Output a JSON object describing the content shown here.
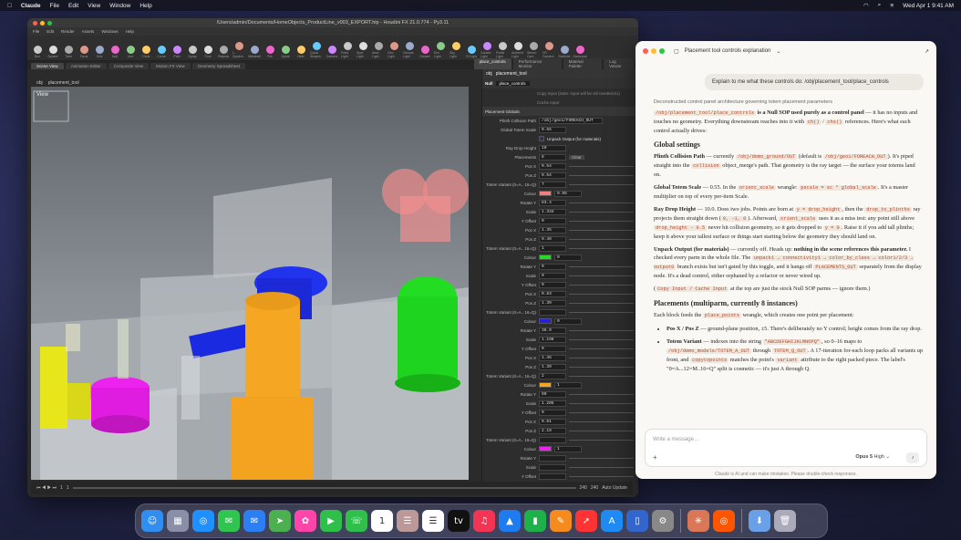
{
  "menubar": {
    "apple": "",
    "app": "Claude",
    "items": [
      "File",
      "Edit",
      "View",
      "Window",
      "Help"
    ],
    "clock": "Wed Apr 1  9:41 AM"
  },
  "houdini": {
    "title": "/Users/admin/Documents/HomeObjects_ProductLine_v003_EXPORT.hip - Houdini FX 21.0.774 - Py3.11",
    "menu": [
      "File",
      "Edit",
      "Render",
      "Assets",
      "Windows",
      "Help"
    ],
    "shelf_tabs": [
      "Create",
      "Modify",
      "Model",
      "Polygon",
      "Deform",
      "Texture",
      "Rigging",
      "Characters",
      "Constraints",
      "Hair Utils",
      "Guide Process",
      "Terrain FX",
      "Simple FX",
      "Volume",
      "Lights and Cameras",
      "Collisions",
      "Particles",
      "Grains",
      "Vellum",
      "RBD",
      "Rigid Bodies",
      "Particle Fl",
      "Viscous Fl",
      "Oceans",
      "SOP Pyro"
    ],
    "tools": [
      "Box",
      "Sphere",
      "Tube",
      "Torus",
      "Grid",
      "Null",
      "Line",
      "Circle",
      "Curve",
      "Path",
      "Spray",
      "Font",
      "Platonic",
      "L-System",
      "Metaball",
      "File",
      "Spiral",
      "Helix",
      "Quick Shapes",
      "Camera",
      "Point Light",
      "Spot Light",
      "Area Light",
      "Geo Light",
      "Volume Light",
      "Distant",
      "Env Light",
      "Sky Light",
      "GI Light",
      "Caustic Light",
      "Portal Light",
      "Ambient Light",
      "Stereo Cam",
      "VR Camera",
      "Switcher",
      "Gamepad"
    ],
    "left_tabs": [
      "Scene View",
      "Animation Editor",
      "Composite View",
      "Motion FX View",
      "Geometry Spreadsheet"
    ],
    "right_tabs": [
      "place_controls",
      "Performance Monitor",
      "Material Palette",
      "Log Viewer"
    ],
    "vp_path": "obj",
    "vp_node": "placement_tool",
    "vp_label": "View",
    "p_path": "obj",
    "p_node": "placement_tool",
    "node_type": "Null",
    "node_name": "place_controls",
    "copy_inputs": [
      "Copy Input (Note: input will be stil needed.Ex)",
      "Cache Input"
    ],
    "folder": "Placement Globals",
    "globals": [
      {
        "label": "Plinth Collision Path",
        "value": "/obj/geo1/FOREACH_OUT"
      },
      {
        "label": "Global Totem Scale",
        "value": "0.55"
      },
      {
        "label": "Unpack Output (for materials)",
        "value": ""
      },
      {
        "label": "Ray Drop Height",
        "value": "10"
      },
      {
        "label": "Placements",
        "value": "8"
      }
    ],
    "clear": "Clear",
    "placements": [
      {
        "px": "0.54",
        "pz": "0.54",
        "tv": "7",
        "col": "#f08080",
        "r": "0.95",
        "ry": "83.4",
        "sc": "1.334",
        "yo": "0"
      },
      {
        "px": "1.35",
        "pz": "0.48",
        "tv": "1",
        "col": "#22dd22",
        "r": "0",
        "ry": "0",
        "sc": "0",
        "yo": "0"
      },
      {
        "px": "0.63",
        "pz": "1.39",
        "tv": "",
        "col": "#2222dd",
        "r": "0",
        "ry": "38.9",
        "sc": "1.198",
        "yo": "0"
      },
      {
        "px": "1.45",
        "pz": "1.39",
        "tv": "2",
        "col": "#f5a623",
        "r": "1",
        "ry": "90",
        "sc": "1.205",
        "yo": "0"
      },
      {
        "px": "0.61",
        "pz": "2.19",
        "tv": "",
        "col": "#ee22ee",
        "r": "1",
        "ry": "",
        "sc": "",
        "yo": ""
      }
    ],
    "row_labels": {
      "px": "Pos X",
      "pz": "Pos Z",
      "tv": "Totem Variant (0=A.. 16=Q)",
      "col": "Colour",
      "ry": "Rotate Y",
      "sc": "Scale",
      "yo": "Y Offset"
    },
    "frame_start": "1",
    "frame_cur": "1",
    "frame_end": "240",
    "frame_end2": "240",
    "auto_update": "Auto Update"
  },
  "claude": {
    "title": "Placement tool controls explanation",
    "user_msg": "Explain to me what these controls do: /obj/placement_tool/place_controls",
    "intro_note": "Deconstructed control panel architecture governing totem placement parameters",
    "p1a": "/obj/placement_tool/place_controls",
    "p1b": " is a Null SOP used purely as a control panel",
    "p1c": " — it has no inputs and touches no geometry. Everything downstream reaches into it with ",
    "p1d": "ch()",
    "p1e": " / ",
    "p1f": "chs()",
    "p1g": " references. Here's what each control actually drives:",
    "h_global": "Global settings",
    "g1_b": "Plinth Collision Path",
    "g1_t": " — currently ",
    "g1_c": "/obj/demo_ground/OUT",
    "g1_t2": " (default is ",
    "g1_c2": "/obj/geo1/FOREACH_OUT",
    "g1_t3": "). It's piped straight into the ",
    "g1_c3": "collision",
    "g1_t4": " object_merge's path. That geometry is the ray target — the surface your totems land on.",
    "g2_b": "Global Totem Scale",
    "g2_t": " — 0.55. In the ",
    "g2_c": "orient_scale",
    "g2_t2": " wrangle: ",
    "g2_c2": "pscale = sc * global_scale",
    "g2_t3": ". It's a master multiplier on top of every per-item Scale.",
    "g3_b": "Ray Drop Height",
    "g3_t": " — 10.0. Does two jobs. Points are born at ",
    "g3_c": "y = drop_height",
    "g3_t2": ", then the ",
    "g3_c2": "drop_to_plinths",
    "g3_t3": " ray projects them straight down (",
    "g3_c3": "0, -1, 0",
    "g3_t4": "). Afterward, ",
    "g3_c4": "orient_scale",
    "g3_t5": " uses it as a miss test: any point still above ",
    "g3_c5": "drop_height - 0.5",
    "g3_t6": " never hit collision geometry, so it gets dropped to ",
    "g3_c6": "y = 0",
    "g3_t7": ". Raise it if you add tall plinths; keep it above your tallest surface or things start starting below the geometry they should land on.",
    "g4_b": "Unpack Output (for materials)",
    "g4_t": " — currently off. Heads up: ",
    "g4_b2": "nothing in the scene references this parameter.",
    "g4_t2": " I checked every parm in the whole file. The ",
    "g4_c": "unpack1 → connectivity1 → color_by_class → color1/2/3 → output0",
    "g4_t3": " branch exists but isn't gated by this toggle, and it hangs off ",
    "g4_c2": "PLACEMENTS_OUT",
    "g4_t4": " separately from the display node. It's a dead control, either orphaned by a refactor or never wired up.",
    "g5_t": "(",
    "g5_c": "Copy Input / Cache Input",
    "g5_t2": " at the top are just the stock Null SOP parms — ignore them.)",
    "h_place": "Placements (multiparm, currently 8 instances)",
    "pl_t": "Each block feeds the ",
    "pl_c": "place_points",
    "pl_t2": " wrangle, which creates one point per placement:",
    "b1_b": "Pos X / Pos Z",
    "b1_t": " — ground-plane position, ±5. There's deliberately no Y control; height comes from the ray drop.",
    "b2_b": "Totem Variant",
    "b2_t": " — indexes into the string ",
    "b2_c": "\"ABCDEFGHIJKLMNOPQ\"",
    "b2_t2": ", so 0–16 maps to ",
    "b2_c2": "/obj/demo_models/TOTEM_A_OUT",
    "b2_t3": " through ",
    "b2_c3": "TOTEM_Q_OUT",
    "b2_t4": ". A 17-iteration for-each loop packs all variants up front, and ",
    "b2_c4": "copytopoints",
    "b2_t5": " matches the point's ",
    "b2_c5": "variant",
    "b2_t6": " attribute to the right packed piece. The label's \"0=A...12=M..16=Q\" split is cosmetic — it's just A through Q.",
    "input_placeholder": "Write a message…",
    "plus": "+",
    "model": "Opus 5",
    "effort": "High",
    "footer": "Claude is AI and can make mistakes. Please double-check responses."
  },
  "dock": [
    {
      "name": "finder",
      "color": "#2f8ef0",
      "glyph": "☺"
    },
    {
      "name": "launchpad",
      "color": "#8a8fa8",
      "glyph": "▦"
    },
    {
      "name": "safari",
      "color": "#1e90ff",
      "glyph": "◎"
    },
    {
      "name": "messages",
      "color": "#30c450",
      "glyph": "✉"
    },
    {
      "name": "mail",
      "color": "#2c7ff2",
      "glyph": "✉"
    },
    {
      "name": "maps",
      "color": "#4caf50",
      "glyph": "➤"
    },
    {
      "name": "photos",
      "color": "#f4a",
      "glyph": "✿"
    },
    {
      "name": "facetime",
      "color": "#2fbf4a",
      "glyph": "▶"
    },
    {
      "name": "phone",
      "color": "#2fbf4a",
      "glyph": "☏"
    },
    {
      "name": "calendar",
      "color": "#ffffff",
      "glyph": "1"
    },
    {
      "name": "contacts",
      "color": "#b99",
      "glyph": "☰"
    },
    {
      "name": "reminders",
      "color": "#ffffff",
      "glyph": "☰"
    },
    {
      "name": "tv",
      "color": "#111",
      "glyph": "tv"
    },
    {
      "name": "music",
      "color": "#f33454",
      "glyph": "♫"
    },
    {
      "name": "keynote",
      "color": "#1e7bf0",
      "glyph": "▲"
    },
    {
      "name": "numbers",
      "color": "#1eb14a",
      "glyph": "▮"
    },
    {
      "name": "pages",
      "color": "#f58a1e",
      "glyph": "✎"
    },
    {
      "name": "news",
      "color": "#f33",
      "glyph": "➚"
    },
    {
      "name": "app-store",
      "color": "#1e8af2",
      "glyph": "A"
    },
    {
      "name": "simulator",
      "color": "#3366cc",
      "glyph": "▯"
    },
    {
      "name": "system-settings",
      "color": "#888",
      "glyph": "⚙"
    },
    {
      "name": "claude",
      "color": "#d97757",
      "glyph": "✳"
    },
    {
      "name": "houdini",
      "color": "#ff5500",
      "glyph": "◎"
    },
    {
      "name": "downloads",
      "color": "#6aa0e8",
      "glyph": "⬇"
    },
    {
      "name": "trash",
      "color": "#aab",
      "glyph": "🗑"
    }
  ]
}
